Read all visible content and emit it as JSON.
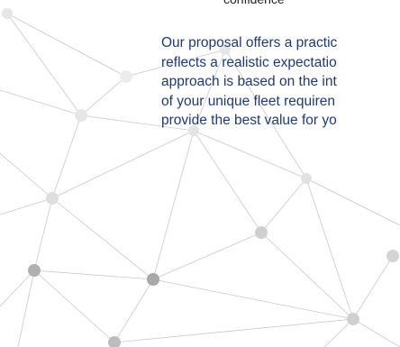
{
  "heading_fragment": "confidence",
  "body_lines": [
    "Our proposal offers a practic",
    "reflects a realistic expectatio",
    "approach is based on the int",
    "of your unique fleet requiren",
    "provide the best value for yo"
  ],
  "decoration": {
    "icon": "network-graph-icon",
    "line_color": "#c8c8c8",
    "node_colors": [
      "#e6e6e6",
      "#d4d4d4",
      "#bdbdbd",
      "#a8a8a8"
    ]
  }
}
